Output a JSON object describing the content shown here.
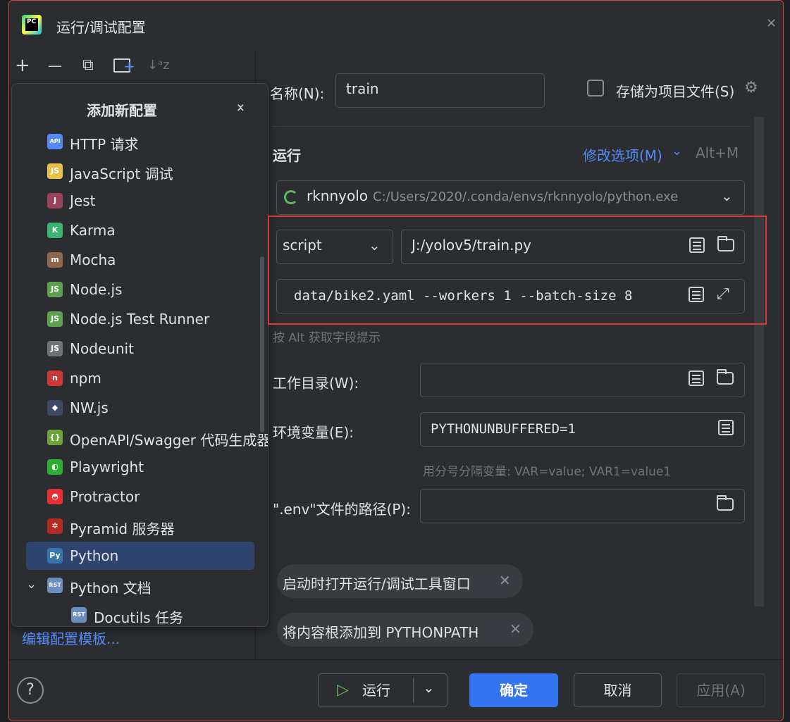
{
  "window": {
    "title": "运行/调试配置",
    "app_icon_text": "PC"
  },
  "toolbar": {
    "add": "+",
    "remove": "—",
    "copy": "⧉",
    "new_folder": "+",
    "sort": "↓ᵃz"
  },
  "popup": {
    "title": "添加新配置",
    "items": [
      {
        "label": "HTTP 请求",
        "icon": "http-api-icon",
        "icon_text": "API",
        "color": "#548af7"
      },
      {
        "label": "JavaScript 调试",
        "icon": "javascript-icon",
        "icon_text": "JS",
        "color": "#e8c14b"
      },
      {
        "label": "Jest",
        "icon": "jest-icon",
        "icon_text": "J",
        "color": "#99425b"
      },
      {
        "label": "Karma",
        "icon": "karma-icon",
        "icon_text": "K",
        "color": "#3cb371"
      },
      {
        "label": "Mocha",
        "icon": "mocha-icon",
        "icon_text": "m",
        "color": "#8d6748"
      },
      {
        "label": "Node.js",
        "icon": "nodejs-icon",
        "icon_text": "JS",
        "color": "#5fa04e"
      },
      {
        "label": "Node.js Test Runner",
        "icon": "nodejs-test-runner-icon",
        "icon_text": "JS",
        "color": "#5fa04e"
      },
      {
        "label": "Nodeunit",
        "icon": "nodeunit-icon",
        "icon_text": "JS",
        "color": "#6f737a"
      },
      {
        "label": "npm",
        "icon": "npm-icon",
        "icon_text": "n",
        "color": "#cb3837"
      },
      {
        "label": "NW.js",
        "icon": "nwjs-icon",
        "icon_text": "◆",
        "color": "#3d4a66"
      },
      {
        "label": "OpenAPI/Swagger 代码生成器",
        "icon": "openapi-icon",
        "icon_text": "{}",
        "color": "#6ba539"
      },
      {
        "label": "Playwright",
        "icon": "playwright-icon",
        "icon_text": "◐",
        "color": "#2ead33"
      },
      {
        "label": "Protractor",
        "icon": "protractor-icon",
        "icon_text": "◓",
        "color": "#e23237"
      },
      {
        "label": "Pyramid 服务器",
        "icon": "pyramid-icon",
        "icon_text": "✲",
        "color": "#b22b22"
      },
      {
        "label": "Python",
        "icon": "python-icon",
        "icon_text": "Py",
        "color": "#3776ab"
      },
      {
        "label": "Python 文档",
        "icon": "rst-icon",
        "icon_text": "RST",
        "color": "#6c8ebf"
      },
      {
        "label": "Docutils 任务",
        "icon": "rst-icon",
        "icon_text": "RST",
        "color": "#6c8ebf"
      }
    ]
  },
  "edit_templates": "编辑配置模板...",
  "form": {
    "name_label": "名称(N):",
    "name_value": "train",
    "store_label": "存储为项目文件(S)",
    "section_run": "运行",
    "modify_options": "修改选项(M)",
    "modify_shortcut": "Alt+M",
    "interpreter_name": "rknnyolo",
    "interpreter_path": "C:/Users/2020/.conda/envs/rknnyolo/python.exe",
    "script_type": "script",
    "script_path": "J:/yolov5/train.py",
    "script_params": "data/bike2.yaml --workers 1 --batch-size 8",
    "hint": "按 Alt 获取字段提示",
    "workdir_label": "工作目录(W):",
    "workdir_value": "",
    "env_label": "环境变量(E):",
    "env_value": "PYTHONUNBUFFERED=1",
    "env_hint": "用分号分隔变量: VAR=value; VAR1=value1",
    "dotenv_label": "\".env\"文件的路径(P):",
    "dotenv_value": "",
    "chip_open_tool": "启动时打开运行/调试工具窗口",
    "chip_add_content": "将内容根添加到 PYTHONPATH"
  },
  "buttons": {
    "help": "?",
    "run": "运行",
    "ok": "确定",
    "cancel": "取消",
    "apply": "应用(A)"
  }
}
